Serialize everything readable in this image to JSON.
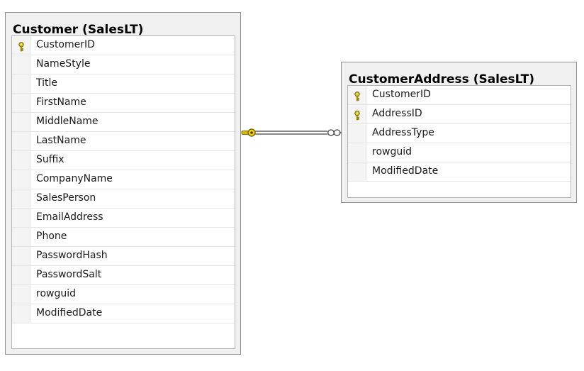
{
  "tables": [
    {
      "title": "Customer (SalesLT)",
      "columns": [
        {
          "name": "CustomerID",
          "key": true
        },
        {
          "name": "NameStyle",
          "key": false
        },
        {
          "name": "Title",
          "key": false
        },
        {
          "name": "FirstName",
          "key": false
        },
        {
          "name": "MiddleName",
          "key": false
        },
        {
          "name": "LastName",
          "key": false
        },
        {
          "name": "Suffix",
          "key": false
        },
        {
          "name": "CompanyName",
          "key": false
        },
        {
          "name": "SalesPerson",
          "key": false
        },
        {
          "name": "EmailAddress",
          "key": false
        },
        {
          "name": "Phone",
          "key": false
        },
        {
          "name": "PasswordHash",
          "key": false
        },
        {
          "name": "PasswordSalt",
          "key": false
        },
        {
          "name": "rowguid",
          "key": false
        },
        {
          "name": "ModifiedDate",
          "key": false
        }
      ]
    },
    {
      "title": "CustomerAddress (SalesLT)",
      "columns": [
        {
          "name": "CustomerID",
          "key": true
        },
        {
          "name": "AddressID",
          "key": true
        },
        {
          "name": "AddressType",
          "key": false
        },
        {
          "name": "rowguid",
          "key": false
        },
        {
          "name": "ModifiedDate",
          "key": false
        }
      ]
    }
  ],
  "relationship": {
    "from_table": "Customer (SalesLT)",
    "to_table": "CustomerAddress (SalesLT)",
    "from_end": "key-one",
    "to_end": "infinity-many"
  },
  "colors": {
    "key_icon": "#d8b400",
    "key_outline": "#6a5a00",
    "line": "#404040"
  },
  "icons": {
    "primary_key": "key-icon"
  }
}
